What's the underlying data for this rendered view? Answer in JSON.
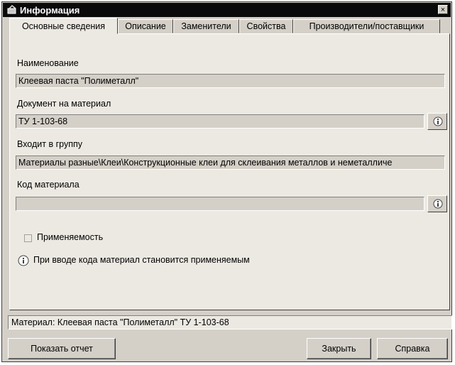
{
  "window": {
    "title": "Информация",
    "close_symbol": "×"
  },
  "tabs": [
    {
      "label": "Основные сведения",
      "active": true
    },
    {
      "label": "Описание",
      "active": false
    },
    {
      "label": "Заменители",
      "active": false
    },
    {
      "label": "Свойства",
      "active": false
    },
    {
      "label": "Производители/поставщики",
      "active": false
    }
  ],
  "fields": {
    "name": {
      "label": "Наименование",
      "value": "Клеевая паста \"Полиметалл\""
    },
    "document": {
      "label": "Документ на материал",
      "value": "ТУ 1-103-68"
    },
    "group": {
      "label": "Входит в группу",
      "value": "Материалы разные\\Клеи\\Конструкционные клеи для склеивания металлов и неметалличе"
    },
    "code": {
      "label": "Код материала",
      "value": ""
    }
  },
  "applicability": {
    "label": "Применяемость",
    "checked": false
  },
  "hint": {
    "text": "При вводе кода материал становится применяемым",
    "icon": "info-icon"
  },
  "status_text": "Материал: Клеевая паста \"Полиметалл\" ТУ 1-103-68",
  "buttons": {
    "report": "Показать отчет",
    "close": "Закрыть",
    "help": "Справка"
  }
}
